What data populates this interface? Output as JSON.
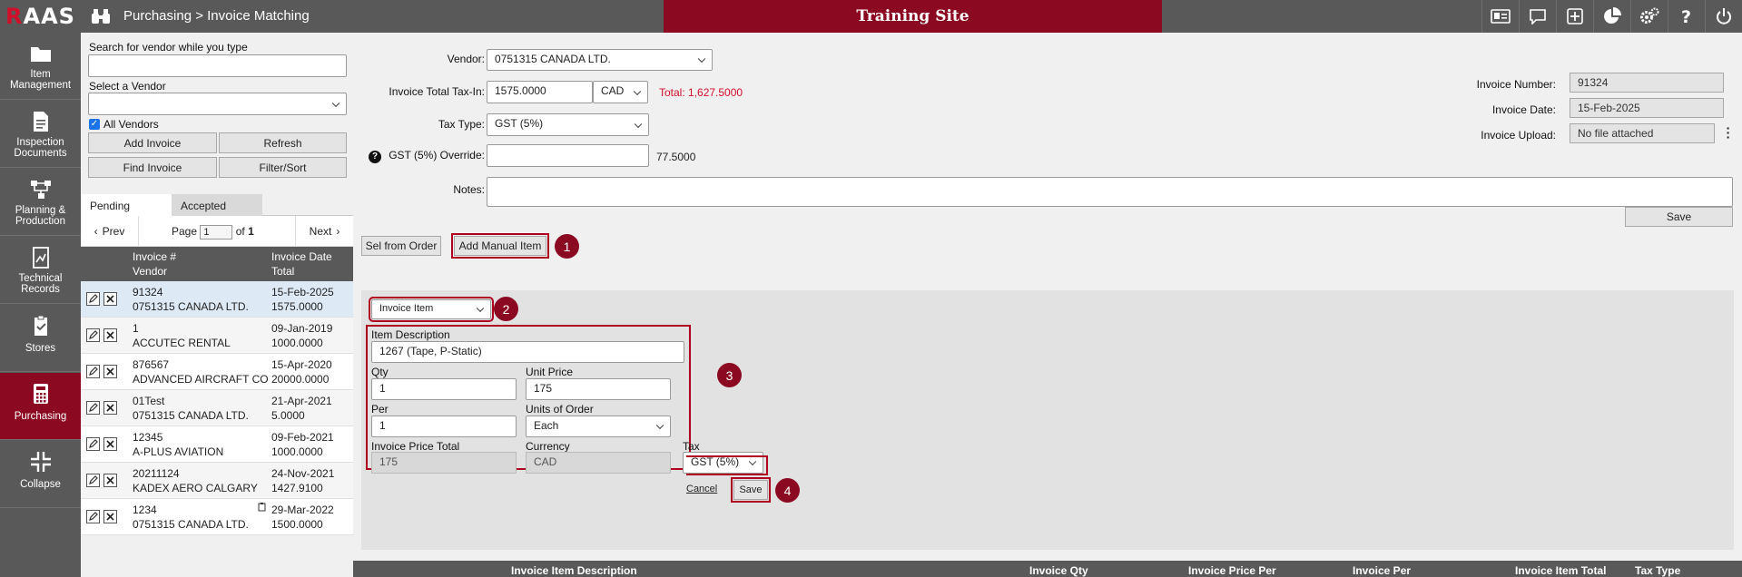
{
  "app": {
    "logo_r": "R",
    "logo_rest": "AAS",
    "breadcrumb": "Purchasing > Invoice Matching",
    "training_banner": "Training Site",
    "top_icons": [
      "id-card-icon",
      "chat-icon",
      "plus-square-icon",
      "pie-chart-icon",
      "gears-icon",
      "help-icon",
      "power-icon"
    ]
  },
  "nav": [
    {
      "label1": "Item",
      "label2": "Management",
      "icon": "folder-icon"
    },
    {
      "label1": "Inspection",
      "label2": "Documents",
      "icon": "document-icon"
    },
    {
      "label1": "Planning &",
      "label2": "Production",
      "icon": "flow-icon"
    },
    {
      "label1": "Technical",
      "label2": "Records",
      "icon": "records-icon"
    },
    {
      "label1": "Stores",
      "label2": "",
      "icon": "clipboard-icon"
    },
    {
      "label1": "Purchasing",
      "label2": "",
      "icon": "calculator-icon"
    },
    {
      "label1": "Collapse",
      "label2": "",
      "icon": "collapse-icon"
    }
  ],
  "vendor_panel": {
    "search_label": "Search for vendor while you type",
    "search_value": "",
    "select_label": "Select a Vendor",
    "select_value": "",
    "all_vendors_label": "All Vendors",
    "btn_add_invoice": "Add Invoice",
    "btn_refresh": "Refresh",
    "btn_find_invoice": "Find Invoice",
    "btn_filter_sort": "Filter/Sort",
    "tab_pending": "Pending",
    "tab_accepted": "Accepted",
    "prev": "Prev",
    "next": "Next",
    "page_label": "Page",
    "page_value": "1",
    "page_of": "of",
    "page_total": "1",
    "col_invoice": "Invoice #",
    "col_vendor": "Vendor",
    "col_date": "Invoice Date",
    "col_total": "Total",
    "invoices": [
      {
        "num": "91324",
        "vendor": "0751315 CANADA LTD.",
        "date": "15-Feb-2025",
        "total": "1575.0000"
      },
      {
        "num": "1",
        "vendor": "ACCUTEC RENTAL",
        "date": "09-Jan-2019",
        "total": "1000.0000"
      },
      {
        "num": "876567",
        "vendor": "ADVANCED AIRCRAFT CO",
        "date": "15-Apr-2020",
        "total": "20000.0000"
      },
      {
        "num": "01Test",
        "vendor": "0751315 CANADA LTD.",
        "date": "21-Apr-2021",
        "total": "5.0000"
      },
      {
        "num": "12345",
        "vendor": "A-PLUS AVIATION",
        "date": "09-Feb-2021",
        "total": "1000.0000"
      },
      {
        "num": "20211124",
        "vendor": "KADEX AERO CALGARY",
        "date": "24-Nov-2021",
        "total": "1427.9100"
      },
      {
        "num": "1234",
        "vendor": "0751315 CANADA LTD.",
        "date": "29-Mar-2022",
        "total": "1500.0000"
      }
    ]
  },
  "invoice_form": {
    "vendor_label": "Vendor:",
    "vendor_value": "0751315 CANADA LTD.",
    "total_label": "Invoice Total Tax-In:",
    "total_value": "1575.0000",
    "currency_value": "CAD",
    "total_calc": "Total: 1,627.5000",
    "taxtype_label": "Tax Type:",
    "taxtype_value": "GST (5%)",
    "override_label": "GST (5%) Override:",
    "override_value": "",
    "override_amount": "77.5000",
    "notes_label": "Notes:",
    "notes_value": "",
    "invoice_number_label": "Invoice Number:",
    "invoice_number_value": "91324",
    "invoice_date_label": "Invoice Date:",
    "invoice_date_value": "15-Feb-2025",
    "invoice_upload_label": "Invoice Upload:",
    "invoice_upload_value": "No file attached",
    "save_label": "Save",
    "btn_sel_from_order": "Sel from Order",
    "btn_add_manual_item": "Add Manual Item"
  },
  "manual_item": {
    "item_type_value": "Invoice Item",
    "desc_label": "Item Description",
    "desc_value": "1267 (Tape, P-Static)",
    "qty_label": "Qty",
    "qty_value": "1",
    "unit_price_label": "Unit Price",
    "unit_price_value": "175",
    "per_label": "Per",
    "per_value": "1",
    "uoo_label": "Units of Order",
    "uoo_value": "Each",
    "ipt_label": "Invoice Price Total",
    "ipt_value": "175",
    "currency_label": "Currency",
    "currency_value": "CAD",
    "tax_label": "Tax",
    "tax_value": "GST (5%)",
    "cancel_label": "Cancel",
    "save_label": "Save"
  },
  "badges": [
    "1",
    "2",
    "3",
    "4"
  ],
  "items_table": {
    "headers": [
      "Invoice Item Description",
      "Invoice Qty",
      "Invoice Price Per",
      "Invoice Per",
      "Invoice Item Total",
      "Tax Type"
    ]
  },
  "colors": {
    "brand": "#8b0a21",
    "chrome": "#595959",
    "accent_red": "#d0102b"
  }
}
